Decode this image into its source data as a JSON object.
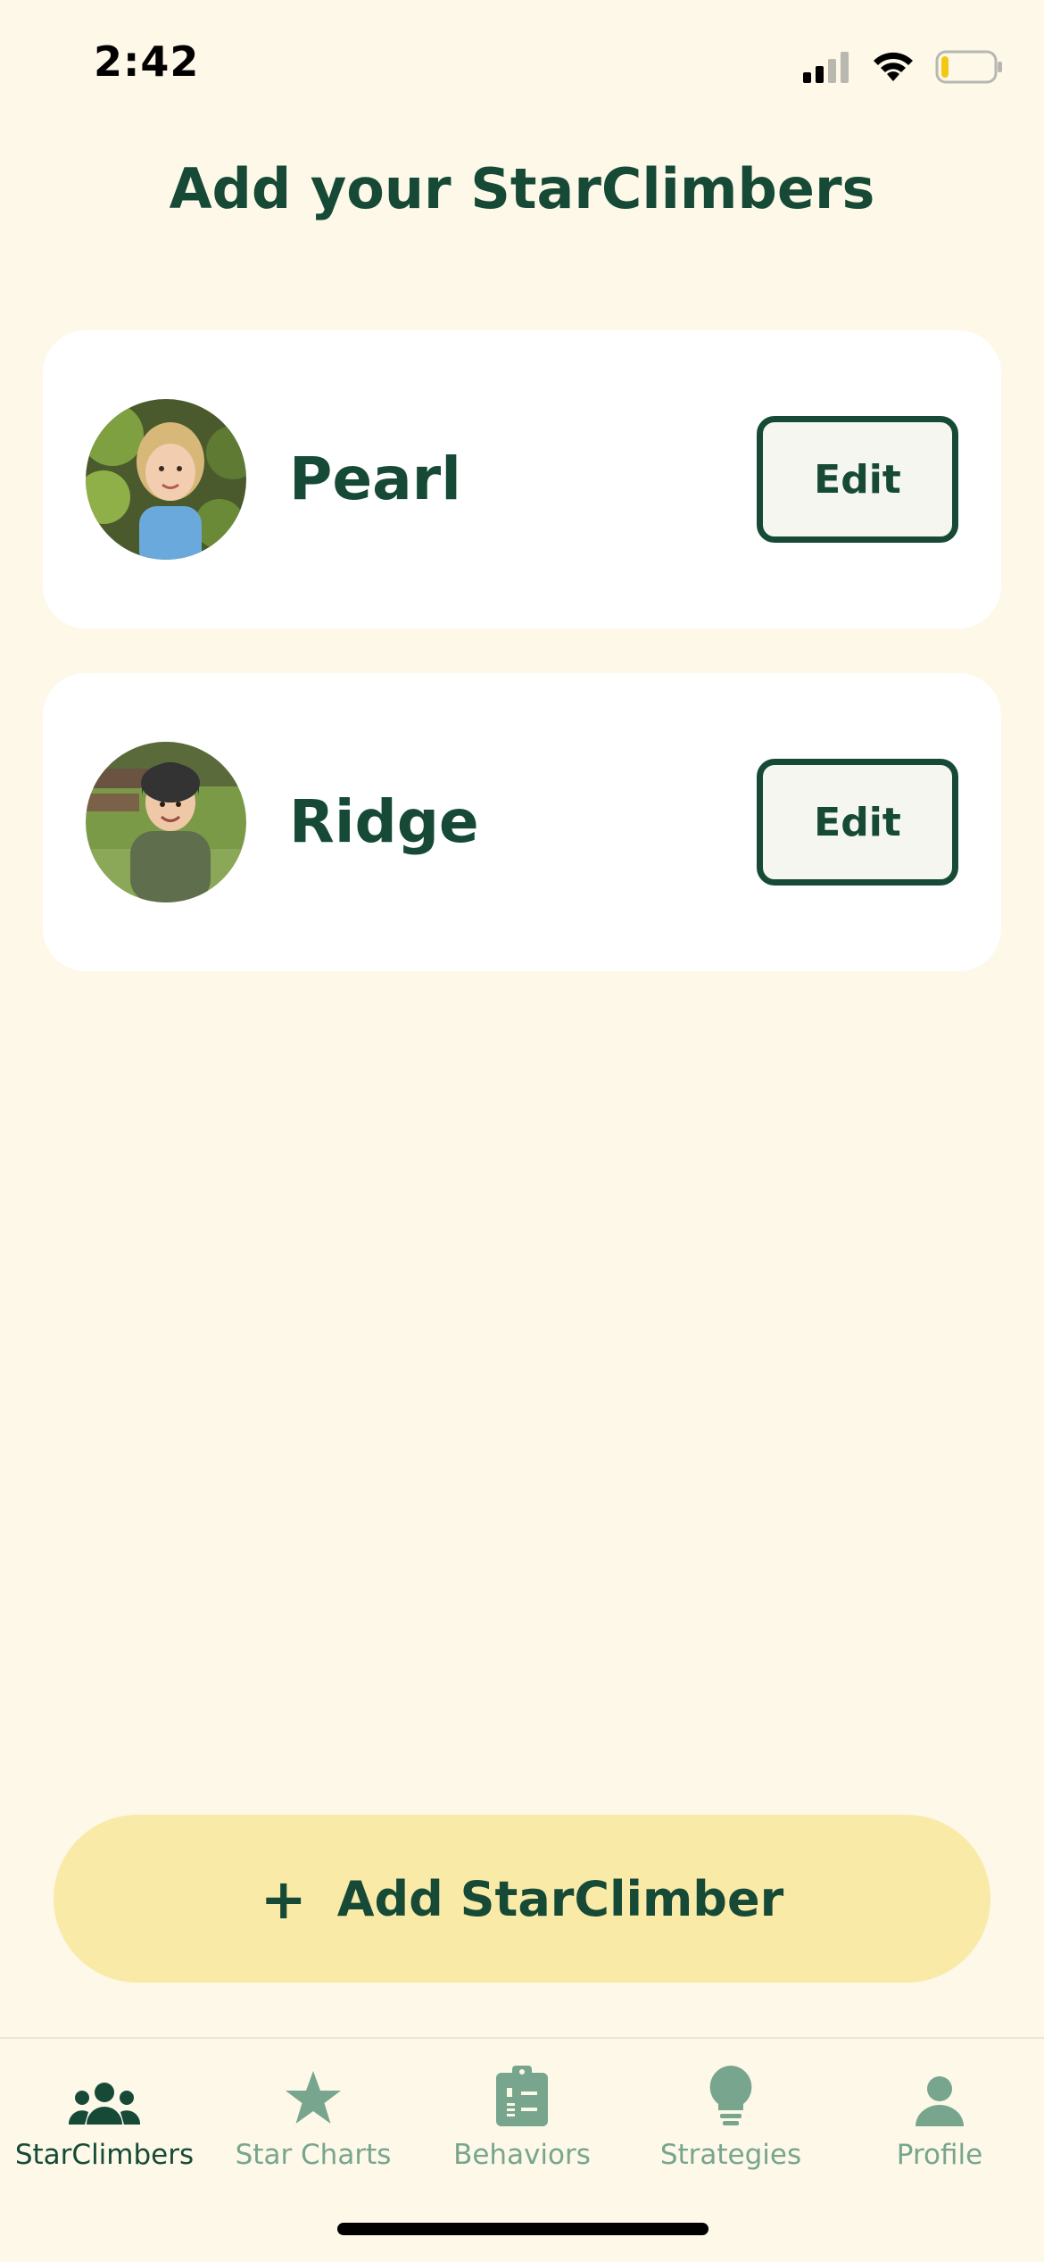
{
  "status_bar": {
    "time": "2:42"
  },
  "page": {
    "title": "Add your StarClimbers"
  },
  "climbers": [
    {
      "name": "Pearl",
      "edit_label": "Edit"
    },
    {
      "name": "Ridge",
      "edit_label": "Edit"
    }
  ],
  "add_button": {
    "plus": "+",
    "label": "Add StarClimber"
  },
  "tabs": [
    {
      "label": "StarClimbers",
      "icon": "people-icon",
      "active": true
    },
    {
      "label": "Star Charts",
      "icon": "star-icon",
      "active": false
    },
    {
      "label": "Behaviors",
      "icon": "clipboard-list-icon",
      "active": false
    },
    {
      "label": "Strategies",
      "icon": "lightbulb-icon",
      "active": false
    },
    {
      "label": "Profile",
      "icon": "person-icon",
      "active": false
    }
  ],
  "colors": {
    "background": "#fdf8e8",
    "primary_green": "#164a36",
    "inactive_tab": "#78a58e",
    "add_button_bg": "#faeaa8",
    "card_bg": "#ffffff",
    "battery_level": "#f2c814"
  },
  "battery": {
    "level_fraction": 0.15
  }
}
